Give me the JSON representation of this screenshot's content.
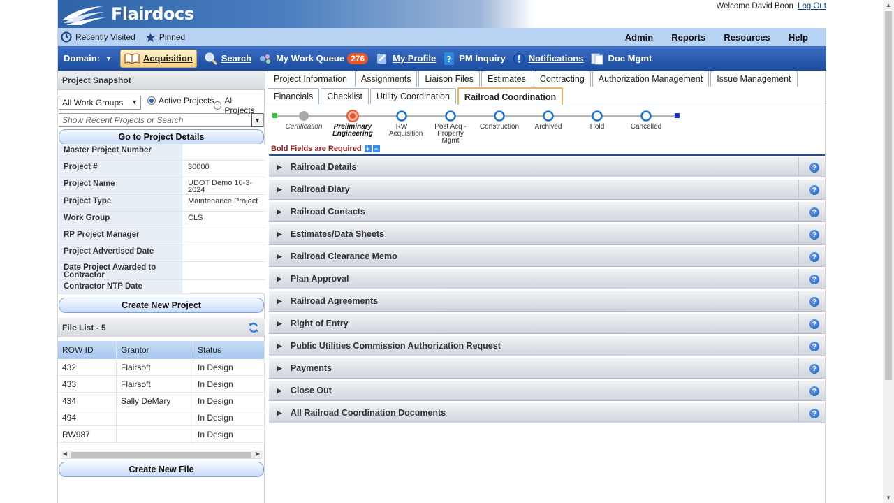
{
  "app": {
    "logo": "Flairdocs",
    "welcome": "Welcome David Boon",
    "logout": "Log Out"
  },
  "utilbar": {
    "recent": "Recently Visited",
    "pinned": "Pinned",
    "right": [
      "Admin",
      "Reports",
      "Resources",
      "Help"
    ]
  },
  "nav": {
    "domain": "Domain:",
    "items": [
      {
        "label": "Acquisition",
        "icon": "book-icon",
        "active": true
      },
      {
        "label": "Search",
        "icon": "magnifier-icon"
      },
      {
        "label": "My Work Queue",
        "icon": "workqueue-icon",
        "badge": "276"
      },
      {
        "label": "My Profile",
        "icon": "profile-icon"
      },
      {
        "label": "PM Inquiry",
        "icon": "help-book-icon"
      },
      {
        "label": "Notifications",
        "icon": "alert-icon"
      },
      {
        "label": "Doc Mgmt",
        "icon": "documents-icon"
      }
    ]
  },
  "snapshot": {
    "title": "Project Snapshot",
    "workgroup": "All Work Groups",
    "radio_active": "Active Projects",
    "radio_all": "All Projects",
    "search_placeholder": "Show Recent Projects or Search",
    "goto_button": "Go to Project Details",
    "fields": [
      {
        "label": "Master Project Number",
        "value": ""
      },
      {
        "label": "Project #",
        "value": "30000"
      },
      {
        "label": "Project Name",
        "value": "UDOT Demo 10-3-2024"
      },
      {
        "label": "Project Type",
        "value": "Maintenance Project"
      },
      {
        "label": "Work Group",
        "value": "CLS"
      },
      {
        "label": "RP Project Manager",
        "value": ""
      },
      {
        "label": "Project Advertised Date",
        "value": ""
      },
      {
        "label": "Date Project Awarded to Contractor",
        "value": ""
      },
      {
        "label": "Contractor NTP Date",
        "value": ""
      }
    ],
    "create_project": "Create New Project"
  },
  "filelist": {
    "title": "File List - 5",
    "columns": [
      "ROW ID",
      "Grantor",
      "Status"
    ],
    "rows": [
      [
        "432",
        "Flairsoft",
        "In Design"
      ],
      [
        "433",
        "Flairsoft",
        "In Design"
      ],
      [
        "434",
        "Sally DeMary",
        "In Design"
      ],
      [
        "494",
        "",
        "In Design"
      ],
      [
        "RW987",
        "",
        "In Design"
      ]
    ],
    "create_file": "Create New File"
  },
  "tabs": {
    "row1": [
      "Project Information",
      "Assignments",
      "Liaison Files",
      "Estimates",
      "Contracting",
      "Authorization Management",
      "Issue Management"
    ],
    "row2": [
      "Financials",
      "Checklist",
      "Utility Coordination",
      "Railroad Coordination"
    ],
    "active": "Railroad Coordination"
  },
  "stages": [
    {
      "label": "Certification",
      "state": "past"
    },
    {
      "label": "Preliminary Engineering",
      "state": "current"
    },
    {
      "label": "RW Acquisition",
      "state": "future"
    },
    {
      "label": "Post Acq - Property Mgmt",
      "state": "future"
    },
    {
      "label": "Construction",
      "state": "future"
    },
    {
      "label": "Archived",
      "state": "future"
    },
    {
      "label": "Hold",
      "state": "future"
    },
    {
      "label": "Cancelled",
      "state": "future"
    }
  ],
  "required_note": "Bold Fields are Required",
  "sections": [
    "Railroad Details",
    "Railroad Diary",
    "Railroad Contacts",
    "Estimates/Data Sheets",
    "Railroad Clearance Memo",
    "Plan Approval",
    "Railroad Agreements",
    "Right of Entry",
    "Public Utilities Commission Authorization Request",
    "Payments",
    "Close Out",
    "All Railroad Coordination Documents"
  ],
  "colors": {
    "nav": "#1d4c9f",
    "accent": "#f0b44a",
    "current_stage": "#e8552a",
    "stage_ring": "#1a74d8"
  }
}
